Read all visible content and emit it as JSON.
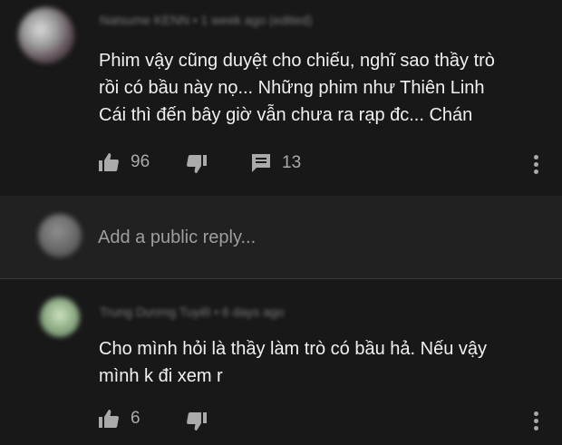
{
  "comments": [
    {
      "author": "Natsume KENN",
      "timestamp": "1 week ago (edited)",
      "text": "Phim vậy cũng duyệt cho chiếu, nghĩ sao thầy trò\nrồi có bầu này nọ... Những phim như Thiên Linh\nCái thì đến bây giờ vẫn chưa ra rạp đc... Chán",
      "likes": "96",
      "replies": "13"
    },
    {
      "author": "Trung Dương Tuyết",
      "timestamp": "6 days ago",
      "text": "Cho mình hỏi là thầy làm trò có bầu hả. Nếu vậy\nmình k đi xem r",
      "likes": "6"
    }
  ],
  "reply_box": {
    "placeholder": "Add a public reply..."
  },
  "icons": {
    "like": "thumb-up-icon",
    "dislike": "thumb-down-icon",
    "reply": "comment-icon",
    "more": "more-vertical-icon"
  },
  "colors": {
    "background": "#181818",
    "reply_box_background": "#212121",
    "text": "#f1f1f1",
    "muted": "#aaaaaa"
  }
}
